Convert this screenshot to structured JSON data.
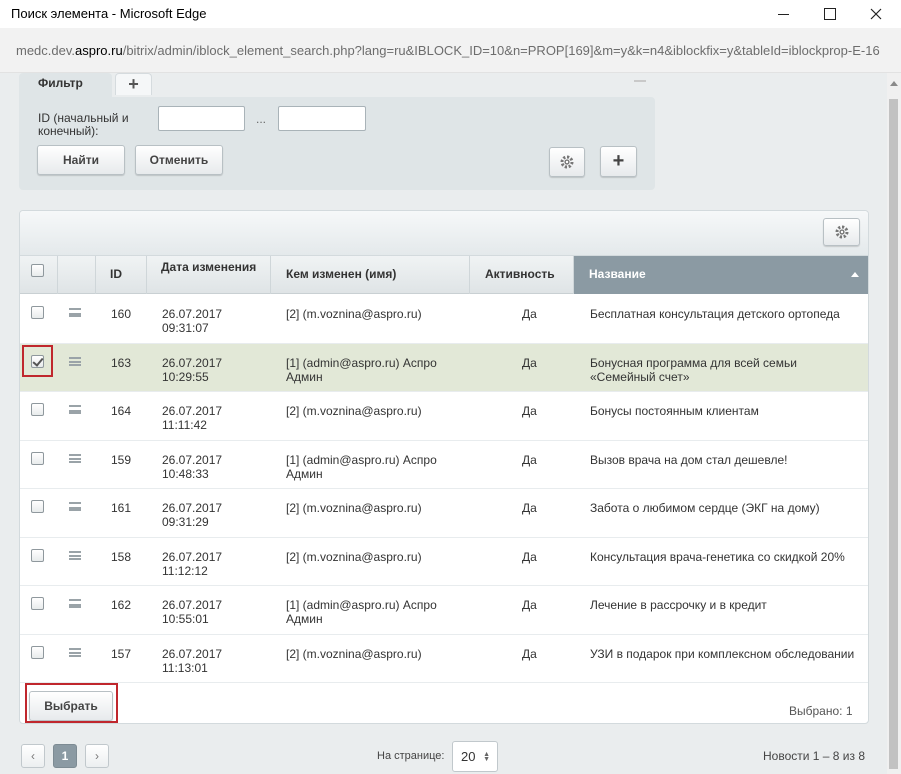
{
  "window": {
    "title": "Поиск элемента - Microsoft Edge",
    "url_prefix": "medc.dev.",
    "url_domain": "aspro.ru",
    "url_rest": "/bitrix/admin/iblock_element_search.php?lang=ru&IBLOCK_ID=10&n=PROP[169]&m=y&k=n4&iblockfix=y&tableId=iblockprop-E-16"
  },
  "filter": {
    "tab_label": "Фильтр",
    "add_tab_label": "+",
    "id_label": "ID (начальный и конечный):",
    "id_from_value": "",
    "id_to_value": "",
    "range_separator": "...",
    "find_label": "Найти",
    "cancel_label": "Отменить",
    "plus_label": "+"
  },
  "grid": {
    "columns": {
      "id": "ID",
      "date": "Дата изменения",
      "user": "Кем изменен (имя)",
      "active": "Активность",
      "name": "Название"
    },
    "rows": [
      {
        "id": "160",
        "date": "26.07.2017 09:31:07",
        "user": "[2] (m.voznina@aspro.ru)",
        "active": "Да",
        "name": "Бесплатная консультация детского ортопеда",
        "checked": false
      },
      {
        "id": "163",
        "date": "26.07.2017 10:29:55",
        "user": "[1] (admin@aspro.ru) Аспро Админ",
        "active": "Да",
        "name": "Бонусная программа для всей семьи «Семейный счет»",
        "checked": true
      },
      {
        "id": "164",
        "date": "26.07.2017 11:11:42",
        "user": "[2] (m.voznina@aspro.ru)",
        "active": "Да",
        "name": "Бонусы постоянным клиентам",
        "checked": false
      },
      {
        "id": "159",
        "date": "26.07.2017 10:48:33",
        "user": "[1] (admin@aspro.ru) Аспро Админ",
        "active": "Да",
        "name": "Вызов врача на дом стал дешевле!",
        "checked": false
      },
      {
        "id": "161",
        "date": "26.07.2017 09:31:29",
        "user": "[2] (m.voznina@aspro.ru)",
        "active": "Да",
        "name": "Забота о любимом сердце (ЭКГ на дому)",
        "checked": false
      },
      {
        "id": "158",
        "date": "26.07.2017 11:12:12",
        "user": "[2] (m.voznina@aspro.ru)",
        "active": "Да",
        "name": "Консультация врача-генетика со скидкой 20%",
        "checked": false
      },
      {
        "id": "162",
        "date": "26.07.2017 10:55:01",
        "user": "[1] (admin@aspro.ru) Аспро Админ",
        "active": "Да",
        "name": "Лечение в рассрочку и в кредит",
        "checked": false
      },
      {
        "id": "157",
        "date": "26.07.2017 11:13:01",
        "user": "[2] (m.voznina@aspro.ru)",
        "active": "Да",
        "name": "УЗИ в подарок при комплексном обследовании",
        "checked": false
      }
    ],
    "select_label": "Выбрать",
    "selected_count": "Выбрано: 1"
  },
  "pager": {
    "prev": "‹",
    "current": "1",
    "next": "›",
    "per_page_label": "На странице:",
    "per_page_value": "20",
    "total": "Новости 1 – 8 из 8"
  },
  "colors": {
    "accent_header": "#8b9aa3",
    "selected_row": "#e2e8d7",
    "highlight_box": "#c0272d"
  }
}
